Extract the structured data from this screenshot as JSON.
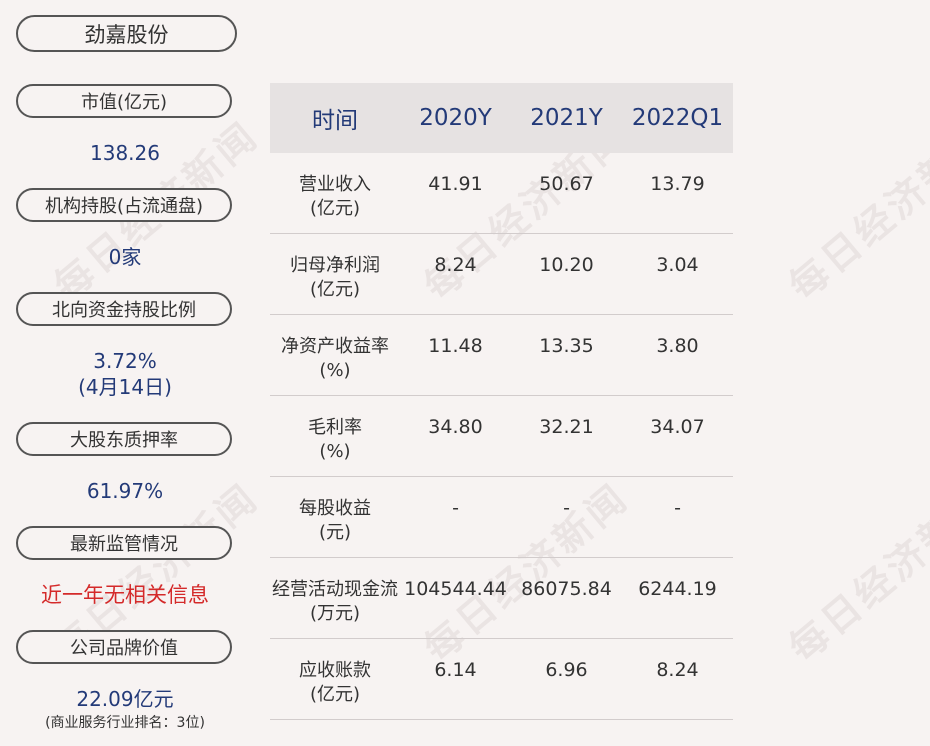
{
  "company": "劲嘉股份",
  "watermark": "每日经济新闻",
  "left_panel": {
    "market_cap": {
      "label": "市值(亿元)",
      "value": "138.26"
    },
    "institution": {
      "label": "机构持股(占流通盘)",
      "value": "0家"
    },
    "northbound": {
      "label": "北向资金持股比例",
      "value": "3.72%",
      "date": "(4月14日)"
    },
    "pledge": {
      "label": "大股东质押率",
      "value": "61.97%"
    },
    "regulation": {
      "label": "最新监管情况",
      "value": "近一年无相关信息"
    },
    "brand": {
      "label": "公司品牌价值",
      "value": "22.09亿元",
      "note": "(商业服务行业排名：3位)"
    }
  },
  "table": {
    "headers": [
      "时间",
      "2020Y",
      "2021Y",
      "2022Q1"
    ],
    "rows": [
      {
        "label1": "营业收入",
        "label2": "(亿元)",
        "v": [
          "41.91",
          "50.67",
          "13.79"
        ]
      },
      {
        "label1": "归母净利润",
        "label2": "(亿元)",
        "v": [
          "8.24",
          "10.20",
          "3.04"
        ]
      },
      {
        "label1": "净资产收益率",
        "label2": "(%)",
        "v": [
          "11.48",
          "13.35",
          "3.80"
        ]
      },
      {
        "label1": "毛利率",
        "label2": "(%)",
        "v": [
          "34.80",
          "32.21",
          "34.07"
        ]
      },
      {
        "label1": "每股收益",
        "label2": "(元)",
        "v": [
          "-",
          "-",
          "-"
        ]
      },
      {
        "label1": "经营活动现金流",
        "label2": "(万元)",
        "v": [
          "104544.44",
          "86075.84",
          "6244.19"
        ]
      },
      {
        "label1": "应收账款",
        "label2": "(亿元)",
        "v": [
          "6.14",
          "6.96",
          "8.24"
        ]
      }
    ]
  }
}
